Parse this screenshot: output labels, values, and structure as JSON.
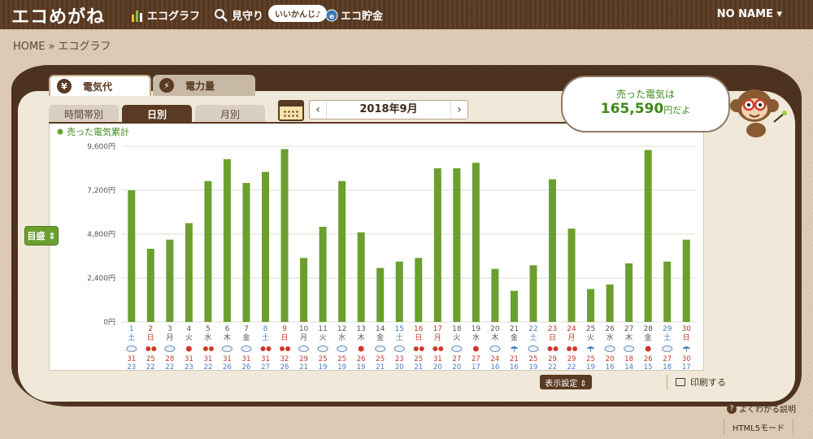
{
  "header": {
    "logo": "エコめがね",
    "nav": [
      {
        "label": "エコグラフ",
        "icon": "bar-chart-icon"
      },
      {
        "label": "見守り",
        "icon": "magnifier-icon"
      },
      {
        "label": "エコ貯金",
        "icon": "coin-icon"
      }
    ],
    "bubble_tag": "いいかんじ♪",
    "user": "NO NAME",
    "user_caret": "▾"
  },
  "breadcrumb": {
    "home": "HOME",
    "sep": "»",
    "current": "エコグラフ"
  },
  "tabs": [
    {
      "label": "電気代",
      "icon": "¥",
      "active": true
    },
    {
      "label": "電力量",
      "icon": "⚡",
      "active": false
    }
  ],
  "subtabs": [
    {
      "label": "時間帯別",
      "active": false
    },
    {
      "label": "日別",
      "active": true
    },
    {
      "label": "月別",
      "active": false
    }
  ],
  "month_nav": {
    "prev": "‹",
    "label": "2018年9月",
    "next": "›"
  },
  "speech": {
    "line1": "売った電気は",
    "amount": "165,590",
    "unit": "円だよ"
  },
  "metric_button": "目盛 ⇕",
  "display_settings": "表示設定 ⇕",
  "print": "印刷する",
  "help": {
    "icon": "?",
    "label": "よくわかる説明"
  },
  "html5": "HTML5モード",
  "colors": {
    "bar": "#6b9f2f",
    "dark_brown": "#5a3a22",
    "sat": "#4a7fc4",
    "sun": "#c0392b",
    "high": "#c0392b",
    "low": "#4a7fc4"
  },
  "chart_data": {
    "type": "bar",
    "legend": "売った電気累計",
    "ylim": [
      0,
      9600
    ],
    "yticks": [
      0,
      2400,
      4800,
      7200,
      9600
    ],
    "ytick_labels": [
      "0円",
      "2,400円",
      "4,800円",
      "7,200円",
      "9,600円"
    ],
    "categories": [
      "1",
      "2",
      "3",
      "4",
      "5",
      "6",
      "7",
      "8",
      "9",
      "10",
      "11",
      "12",
      "13",
      "14",
      "15",
      "16",
      "17",
      "18",
      "19",
      "20",
      "21",
      "22",
      "23",
      "24",
      "25",
      "26",
      "27",
      "28",
      "29",
      "30"
    ],
    "weekday": [
      "土",
      "日",
      "月",
      "火",
      "水",
      "木",
      "金",
      "土",
      "日",
      "月",
      "火",
      "水",
      "木",
      "金",
      "土",
      "日",
      "月",
      "火",
      "水",
      "木",
      "金",
      "土",
      "日",
      "月",
      "火",
      "水",
      "木",
      "金",
      "土",
      "日"
    ],
    "day_kind": [
      "sat",
      "sun",
      "wk",
      "wk",
      "wk",
      "wk",
      "wk",
      "sat",
      "sun",
      "wk",
      "wk",
      "wk",
      "wk",
      "wk",
      "sat",
      "sun",
      "sun",
      "wk",
      "wk",
      "wk",
      "wk",
      "sat",
      "sun",
      "sun",
      "wk",
      "wk",
      "wk",
      "wk",
      "sat",
      "sun"
    ],
    "weather": [
      "cloud",
      "sun-sun",
      "cloud",
      "sun",
      "sun-sun",
      "cloud",
      "cloud",
      "sun-sun",
      "sun-sun",
      "cloud",
      "cloud",
      "cloud",
      "sun",
      "cloud",
      "cloud",
      "sun-sun",
      "sun-sun",
      "cloud",
      "sun",
      "cloud",
      "rain",
      "cloud",
      "sun-sun",
      "sun-sun",
      "rain",
      "cloud",
      "cloud",
      "sun",
      "cloud",
      "rain"
    ],
    "temp_high": [
      31,
      25,
      28,
      31,
      31,
      31,
      31,
      31,
      32,
      29,
      25,
      25,
      26,
      25,
      23,
      25,
      31,
      27,
      27,
      24,
      21,
      25,
      29,
      29,
      25,
      20,
      18,
      26,
      27,
      30
    ],
    "temp_low": [
      23,
      22,
      22,
      23,
      22,
      26,
      26,
      27,
      26,
      21,
      19,
      19,
      19,
      21,
      20,
      21,
      20,
      20,
      17,
      16,
      16,
      19,
      22,
      22,
      19,
      16,
      14,
      15,
      18,
      17
    ],
    "values": [
      7200,
      4000,
      4500,
      5400,
      7700,
      8900,
      7600,
      8200,
      9450,
      3500,
      5200,
      7700,
      4900,
      2950,
      3300,
      3500,
      8400,
      8400,
      8700,
      2900,
      1700,
      3100,
      7800,
      5100,
      1800,
      2050,
      3200,
      9400,
      3300,
      4500
    ]
  }
}
